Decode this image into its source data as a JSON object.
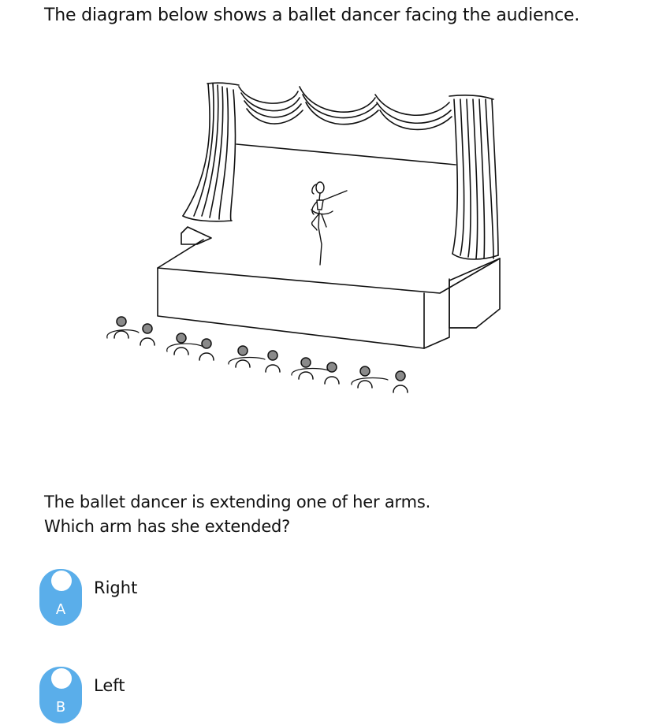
{
  "intro": "The diagram below shows a ballet dancer facing the audience.",
  "question": {
    "line1": "The ballet dancer is extending one of her arms.",
    "line2": "Which arm has she extended?"
  },
  "options": [
    {
      "letter": "A",
      "label": "Right"
    },
    {
      "letter": "B",
      "label": "Left"
    }
  ],
  "colors": {
    "badge": "#5aaeea",
    "ink": "#111111"
  },
  "image": {
    "depicts": [
      "stage",
      "curtains",
      "ballet-dancer",
      "audience"
    ]
  }
}
